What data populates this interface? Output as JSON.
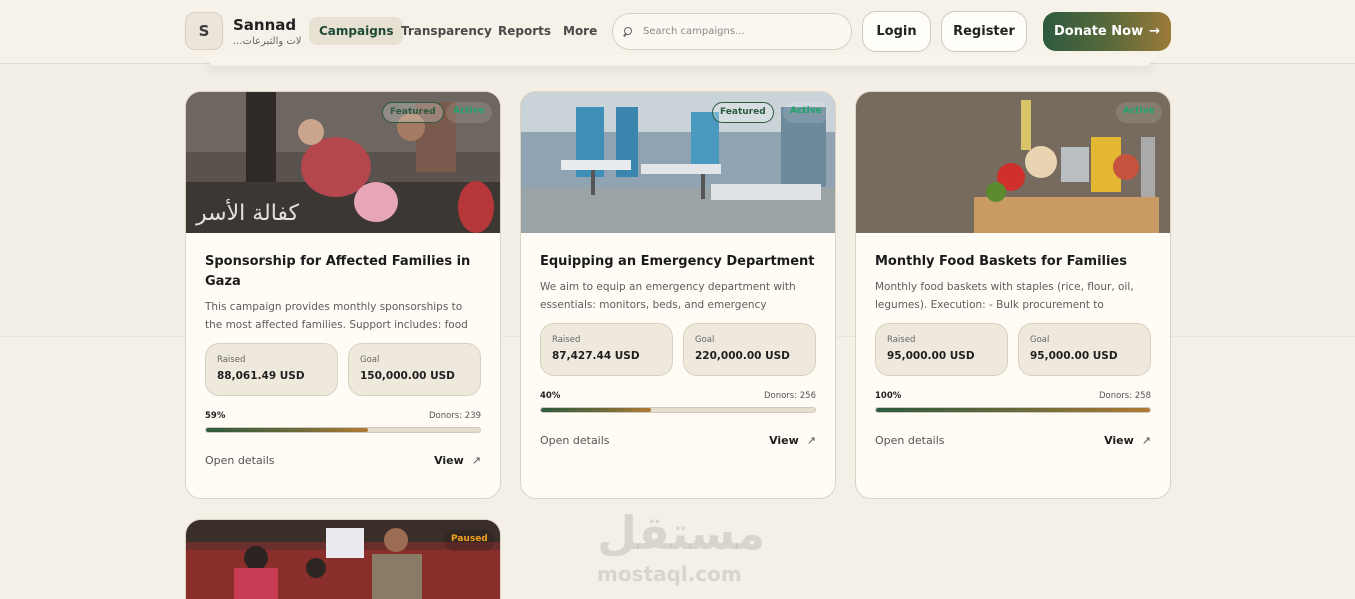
{
  "brand": {
    "initial": "S",
    "name": "Sannad",
    "subtitle": "...لات والتبرعات"
  },
  "nav": [
    {
      "label": "Campaigns",
      "active": true
    },
    {
      "label": "Transparency",
      "active": false
    },
    {
      "label": "Reports",
      "active": false
    },
    {
      "label": "More",
      "active": false
    }
  ],
  "search": {
    "placeholder": "Search campaigns..."
  },
  "auth": {
    "login": "Login",
    "register": "Register"
  },
  "donate": {
    "label": "Donate Now",
    "arrow": "→"
  },
  "colors": {
    "accent": "#2d5a3f",
    "gold": "#b07a35",
    "active_badge": "#1fa46a",
    "paused_badge": "#f3a21e"
  },
  "cards": [
    {
      "badges": [
        "Featured",
        "Active"
      ],
      "image_overlay_text": "كفالة الأسر",
      "title": "Sponsorship for Affected Families in Gaza",
      "description": "This campaign provides monthly sponsorships to the most affected families. Support includes: food parcels,...",
      "raised_label": "Raised",
      "raised": "88,061.49 USD",
      "goal_label": "Goal",
      "goal": "150,000.00 USD",
      "percent_label": "59%",
      "percent": 59,
      "donors": "Donors: 239",
      "open_details": "Open details",
      "view": "View",
      "view_icon": "↗"
    },
    {
      "badges": [
        "Featured",
        "Active"
      ],
      "title": "Equipping an Emergency Department",
      "description": "We aim to equip an emergency department with essentials: monitors, beds, and emergency medicines....",
      "raised_label": "Raised",
      "raised": "87,427.44 USD",
      "goal_label": "Goal",
      "goal": "220,000.00 USD",
      "percent_label": "40%",
      "percent": 40,
      "donors": "Donors: 256",
      "open_details": "Open details",
      "view": "View",
      "view_icon": "↗"
    },
    {
      "badges": [
        "Active"
      ],
      "title": "Monthly Food Baskets for Families",
      "description": "Monthly food baskets with staples (rice, flour, oil, legumes). Execution: - Bulk procurement to reduce...",
      "raised_label": "Raised",
      "raised": "95,000.00 USD",
      "goal_label": "Goal",
      "goal": "95,000.00 USD",
      "percent_label": "100%",
      "percent": 100,
      "donors": "Donors: 258",
      "open_details": "Open details",
      "view": "View",
      "view_icon": "↗"
    },
    {
      "badges": [
        "Paused"
      ]
    }
  ],
  "watermark": {
    "arabic": "مستقل",
    "latin": "mostaql.com"
  }
}
